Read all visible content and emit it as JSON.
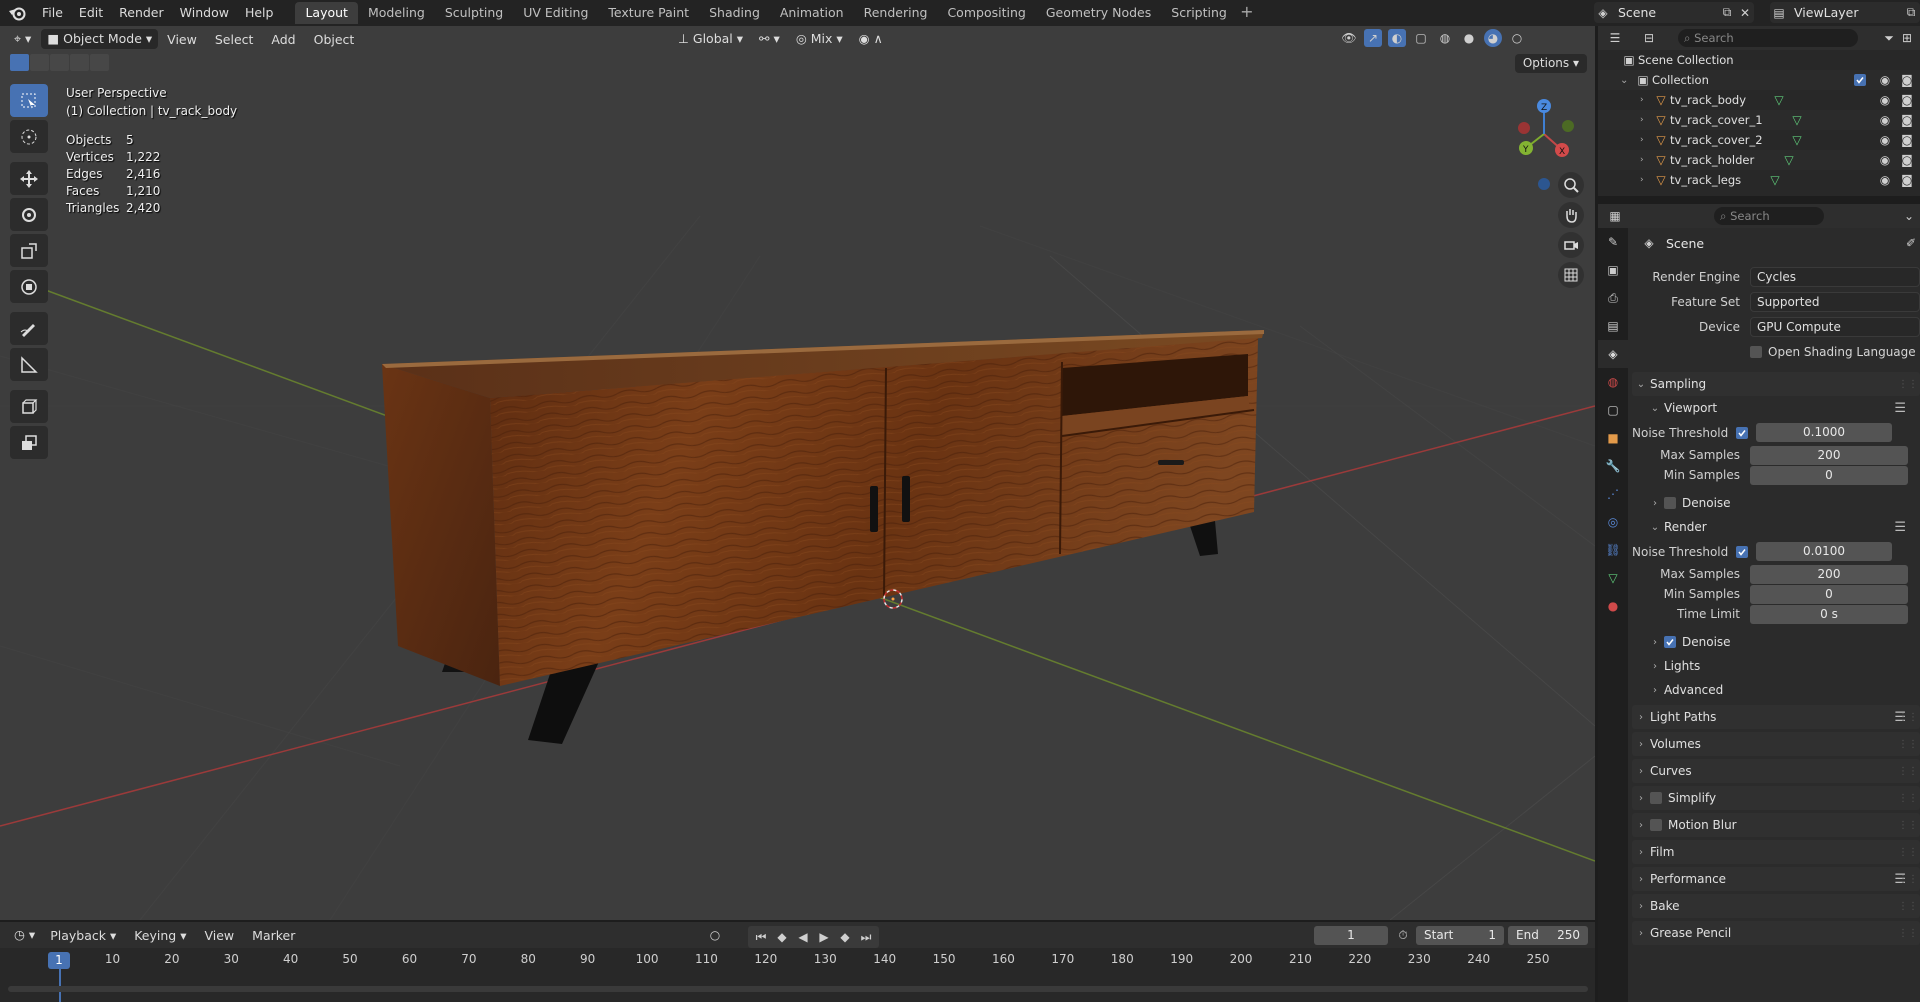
{
  "topbar": {
    "menus": [
      "File",
      "Edit",
      "Render",
      "Window",
      "Help"
    ],
    "workspaces": [
      "Layout",
      "Modeling",
      "Sculpting",
      "UV Editing",
      "Texture Paint",
      "Shading",
      "Animation",
      "Rendering",
      "Compositing",
      "Geometry Nodes",
      "Scripting"
    ],
    "active_workspace": "Layout",
    "scene_name": "Scene",
    "view_layer": "ViewLayer"
  },
  "viewport": {
    "mode": "Object Mode",
    "menus": [
      "View",
      "Select",
      "Add",
      "Object"
    ],
    "orientation": "Global",
    "snap_mode": "Mix",
    "options_label": "Options",
    "perspective": "User Perspective",
    "context": "(1) Collection | tv_rack_body",
    "stats": [
      {
        "label": "Objects",
        "value": "5"
      },
      {
        "label": "Vertices",
        "value": "1,222"
      },
      {
        "label": "Edges",
        "value": "2,416"
      },
      {
        "label": "Faces",
        "value": "1,210"
      },
      {
        "label": "Triangles",
        "value": "2,420"
      }
    ],
    "gizmo_axes": [
      "X",
      "Y",
      "Z"
    ]
  },
  "outliner": {
    "search_placeholder": "Search",
    "root": "Scene Collection",
    "collection": "Collection",
    "objects": [
      "tv_rack_body",
      "tv_rack_cover_1",
      "tv_rack_cover_2",
      "tv_rack_holder",
      "tv_rack_legs"
    ]
  },
  "properties": {
    "search_placeholder": "Search",
    "title": "Scene",
    "render_engine_label": "Render Engine",
    "render_engine": "Cycles",
    "feature_set_label": "Feature Set",
    "feature_set": "Supported",
    "device_label": "Device",
    "device": "GPU Compute",
    "osl_label": "Open Shading Language",
    "sampling": "Sampling",
    "viewport": {
      "title": "Viewport",
      "noise_label": "Noise Threshold",
      "noise": "0.1000",
      "max_label": "Max Samples",
      "max": "200",
      "min_label": "Min Samples",
      "min": "0",
      "denoise_label": "Denoise"
    },
    "render": {
      "title": "Render",
      "noise_label": "Noise Threshold",
      "noise": "0.0100",
      "max_label": "Max Samples",
      "max": "200",
      "min_label": "Min Samples",
      "min": "0",
      "time_label": "Time Limit",
      "time": "0 s",
      "denoise_label": "Denoise"
    },
    "sub_panels": [
      "Lights",
      "Advanced"
    ],
    "panels": [
      "Light Paths",
      "Volumes",
      "Curves",
      "Simplify",
      "Motion Blur",
      "Film",
      "Performance",
      "Bake",
      "Grease Pencil"
    ]
  },
  "timeline": {
    "menus": [
      "Playback",
      "Keying",
      "View",
      "Marker"
    ],
    "current_frame": "1",
    "start_label": "Start",
    "start": "1",
    "end_label": "End",
    "end": "250",
    "ticks": [
      "1",
      "10",
      "20",
      "30",
      "40",
      "50",
      "60",
      "70",
      "80",
      "90",
      "100",
      "110",
      "120",
      "130",
      "140",
      "150",
      "160",
      "170",
      "180",
      "190",
      "200",
      "210",
      "220",
      "230",
      "240",
      "250"
    ]
  },
  "colors": {
    "accent": "#4772b3",
    "viewport_bg": "#3d3d3d",
    "wood": "#6e3514",
    "x_axis": "#b33a3a",
    "y_axis": "#6e8c2c"
  }
}
